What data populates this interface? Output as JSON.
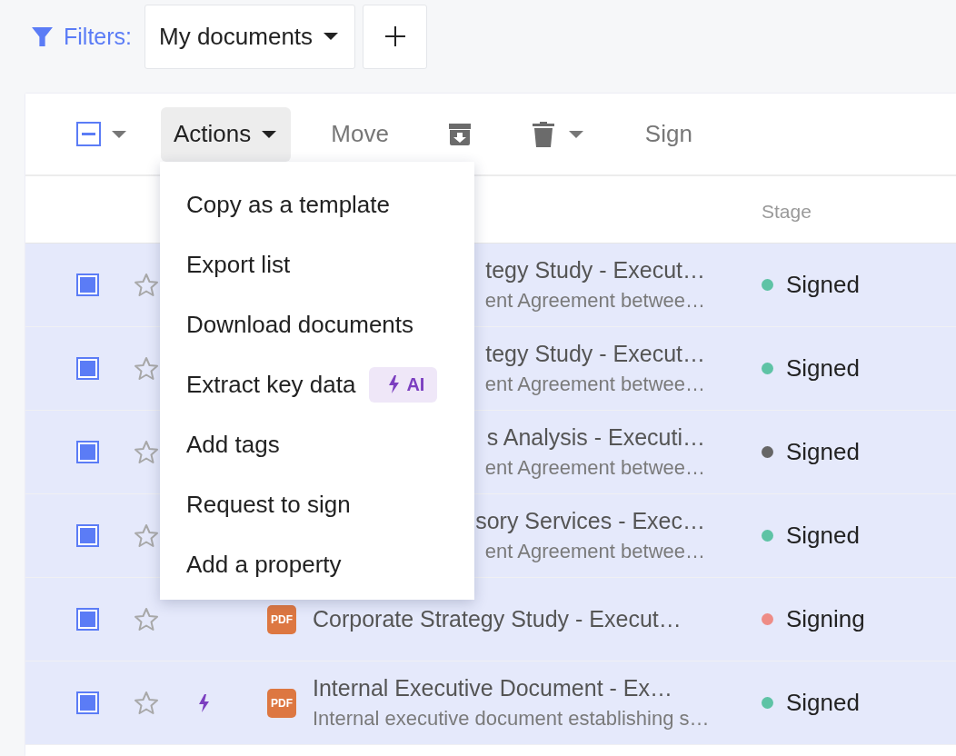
{
  "filters": {
    "label": "Filters:",
    "preset": "My documents"
  },
  "toolbar": {
    "select_all": {
      "indeterminate": true
    },
    "actions": {
      "label": "Actions",
      "open": true
    },
    "move": "Move",
    "sign": "Sign"
  },
  "menu": [
    {
      "label": "Copy as a template"
    },
    {
      "label": "Export list"
    },
    {
      "label": "Download documents"
    },
    {
      "label": "Extract key data",
      "badge": "AI"
    },
    {
      "label": "Add tags"
    },
    {
      "label": "Request to sign"
    },
    {
      "label": "Add a property"
    }
  ],
  "table": {
    "columns": [
      {
        "label": "Stage"
      }
    ],
    "rows": [
      {
        "checked": true,
        "starred": false,
        "title": "tegy Study - Execut…",
        "subtitle": "ent Agreement betwee…",
        "stage": "Signed",
        "color": "#5ec3a5"
      },
      {
        "checked": true,
        "starred": false,
        "title": "tegy Study - Execut…",
        "subtitle": "ent Agreement betwee…",
        "stage": "Signed",
        "color": "#5ec3a5"
      },
      {
        "checked": true,
        "starred": false,
        "title": "s Analysis - Executi…",
        "subtitle": "ent Agreement betwee…",
        "stage": "Signed",
        "color": "#666666"
      },
      {
        "checked": true,
        "starred": false,
        "title": "sory Services - Exec…",
        "subtitle": "ent Agreement betwee…",
        "stage": "Signed",
        "color": "#5ec3a5"
      },
      {
        "checked": true,
        "starred": false,
        "file_badge": "PDF",
        "title": "Corporate Strategy Study - Execut…",
        "stage": "Signing",
        "color": "#ee8c86"
      },
      {
        "checked": true,
        "starred": false,
        "ai": true,
        "file_badge": "PDF",
        "title": "Internal Executive Document - Ex…",
        "subtitle": "Internal executive document establishing s…",
        "stage": "Signed",
        "color": "#5ec3a5"
      }
    ]
  }
}
